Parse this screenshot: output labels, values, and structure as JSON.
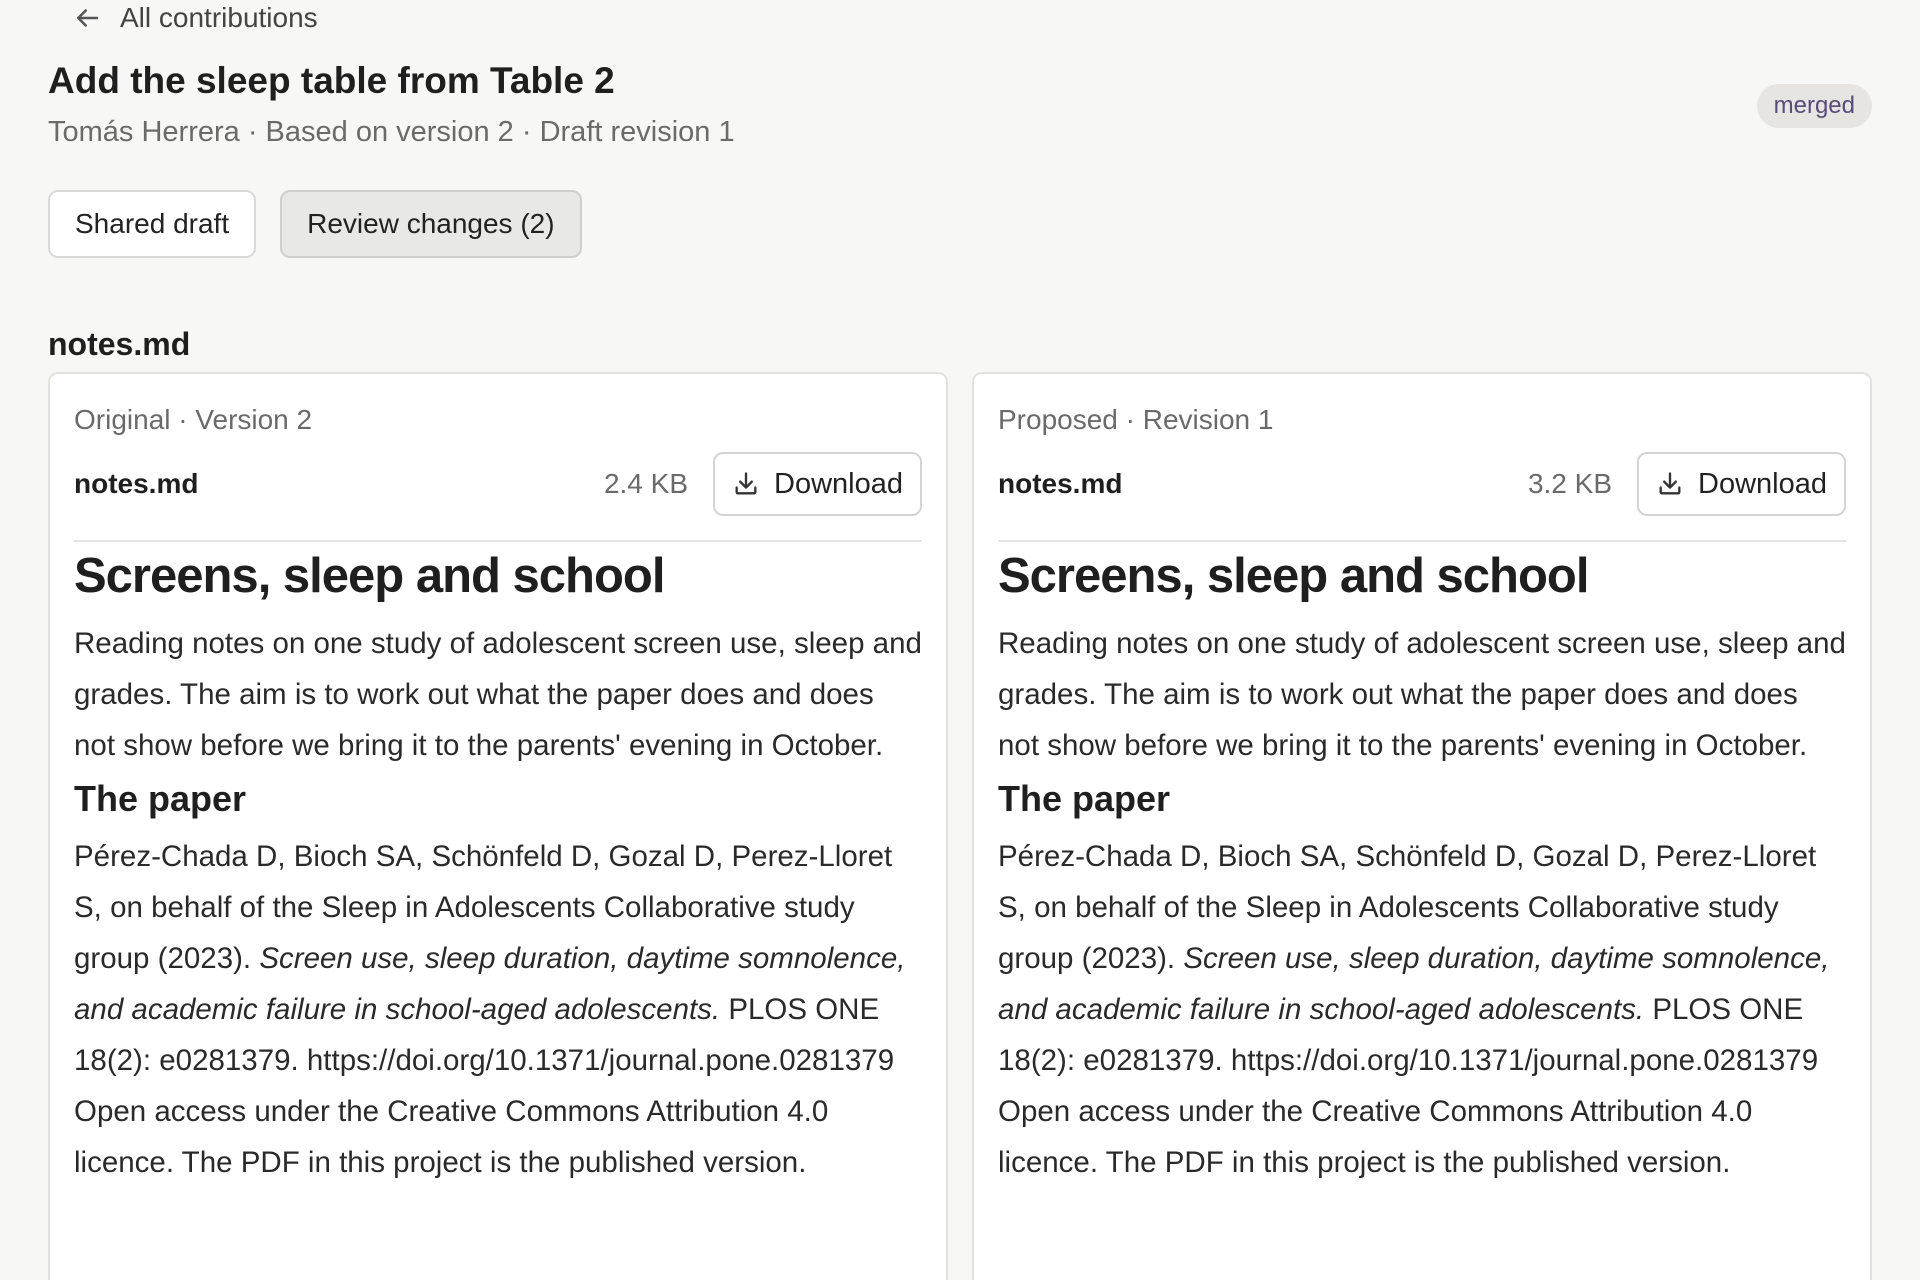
{
  "nav": {
    "back_label": "All contributions"
  },
  "header": {
    "title": "Add the sleep table from Table 2",
    "subtitle": "Tomás Herrera · Based on version 2 · Draft revision 1",
    "status": "merged"
  },
  "tabs": [
    {
      "label": "Shared draft",
      "active": false
    },
    {
      "label": "Review changes (2)",
      "active": true
    }
  ],
  "file_section_title": "notes.md",
  "panels": [
    {
      "caption": "Original · Version 2",
      "file_name": "notes.md",
      "file_size": "2.4 KB",
      "download_label": "Download",
      "doc": {
        "heading": "Screens, sleep and school",
        "intro": "Reading notes on one study of adolescent screen use, sleep and grades. The aim is to work out what the paper does and does not show before we bring it to the parents' evening in October.",
        "section_heading": "The paper",
        "citation_authors": "Pérez-Chada D, Bioch SA, Schönfeld D, Gozal D, Perez-Lloret S, on behalf of the Sleep in Adolescents Collaborative study group (2023).",
        "citation_title": "Screen use, sleep duration, daytime somnolence, and academic failure in school-aged adolescents.",
        "citation_source": "PLOS ONE 18(2): e0281379. https://doi.org/10.1371/journal.pone.0281379",
        "license": "Open access under the Creative Commons Attribution 4.0 licence. The PDF in this project is the published version."
      }
    },
    {
      "caption": "Proposed · Revision 1",
      "file_name": "notes.md",
      "file_size": "3.2 KB",
      "download_label": "Download",
      "doc": {
        "heading": "Screens, sleep and school",
        "intro": "Reading notes on one study of adolescent screen use, sleep and grades. The aim is to work out what the paper does and does not show before we bring it to the parents' evening in October.",
        "section_heading": "The paper",
        "citation_authors": "Pérez-Chada D, Bioch SA, Schönfeld D, Gozal D, Perez-Lloret S, on behalf of the Sleep in Adolescents Collaborative study group (2023).",
        "citation_title": "Screen use, sleep duration, daytime somnolence, and academic failure in school-aged adolescents.",
        "citation_source": "PLOS ONE 18(2): e0281379. https://doi.org/10.1371/journal.pone.0281379",
        "license": "Open access under the Creative Commons Attribution 4.0 licence. The PDF in this project is the published version."
      }
    }
  ]
}
